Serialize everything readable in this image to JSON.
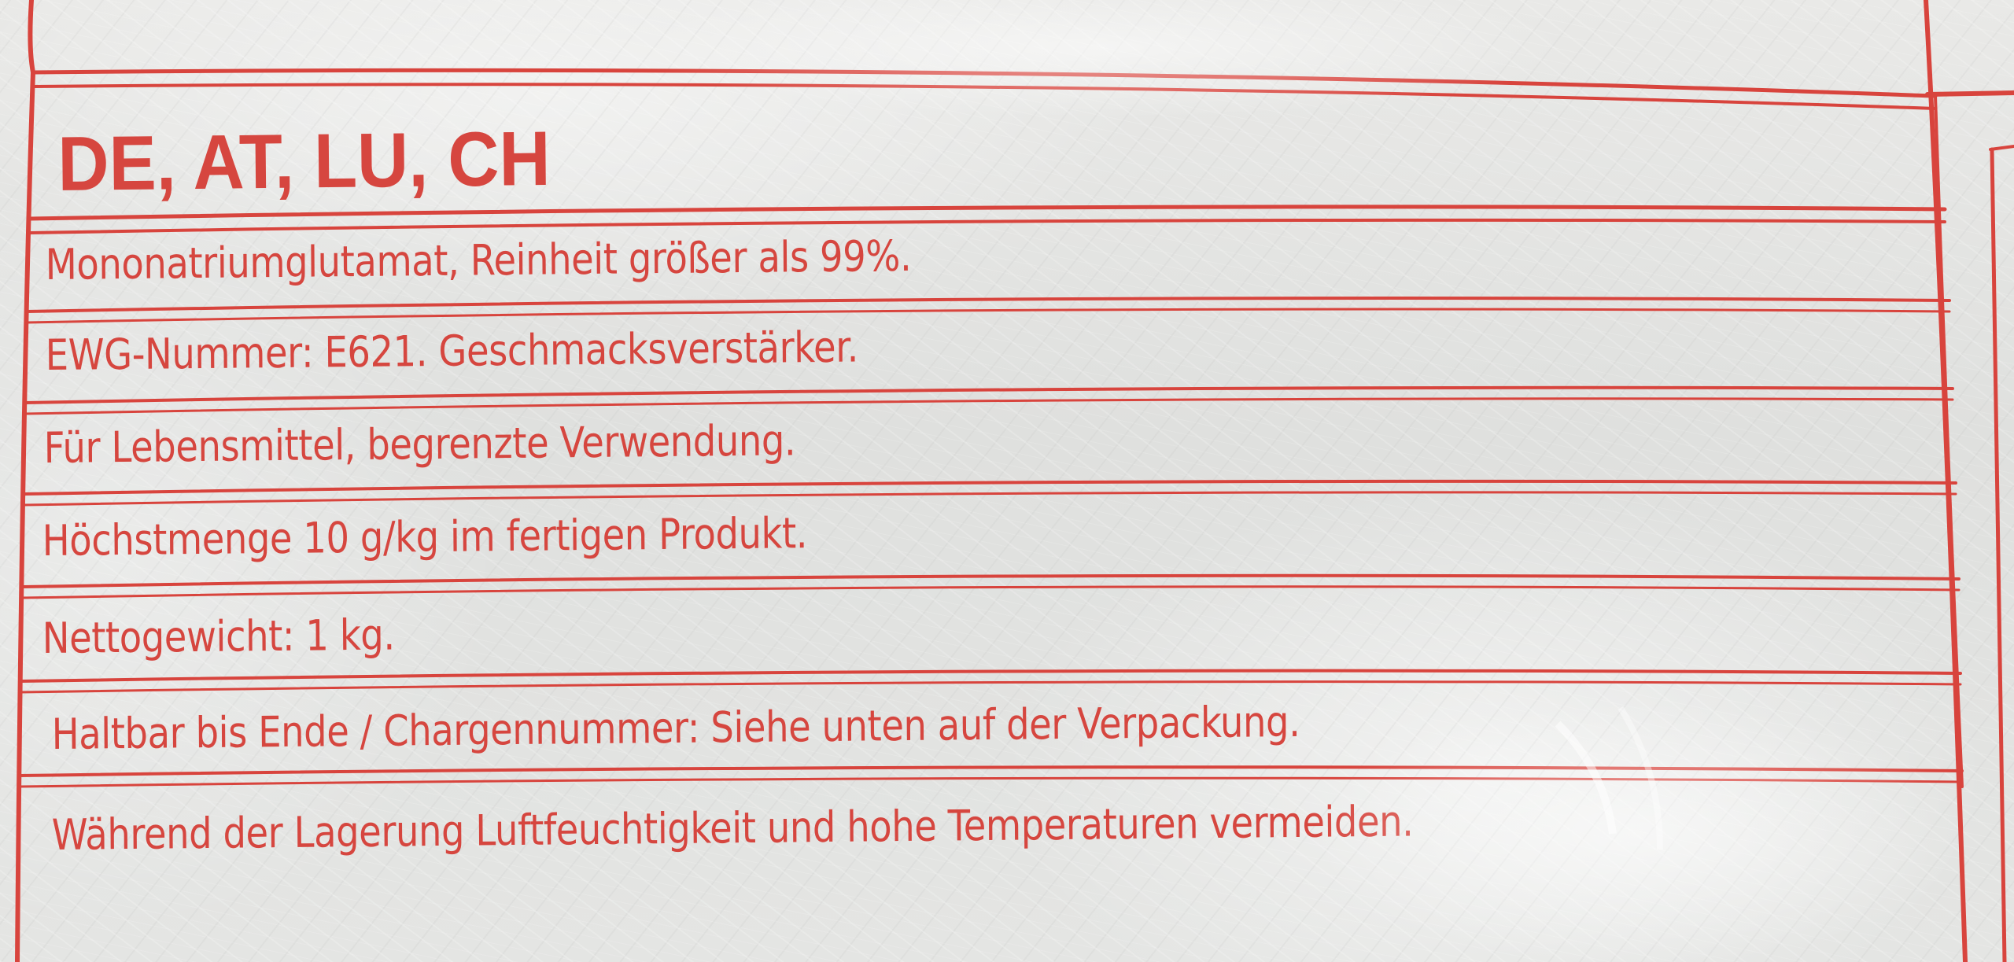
{
  "label": {
    "heading": "DE, AT, LU, CH",
    "lines": [
      "Mononatriumglutamat, Reinheit größer als 99%.",
      "EWG-Nummer: E621. Geschmacksverstärker.",
      "Für Lebensmittel, begrenzte Verwendung.",
      "Höchstmenge 10 g/kg im fertigen Produkt.",
      "Nettogewicht: 1 kg.",
      "Haltbar bis Ende / Chargennummer: Siehe unten auf der Verpackung.",
      "Während der Lagerung Luftfeuchtigkeit und hohe Temperaturen vermeiden."
    ],
    "ink_color": "#d6463f",
    "background_color": "#e4e5e3"
  }
}
